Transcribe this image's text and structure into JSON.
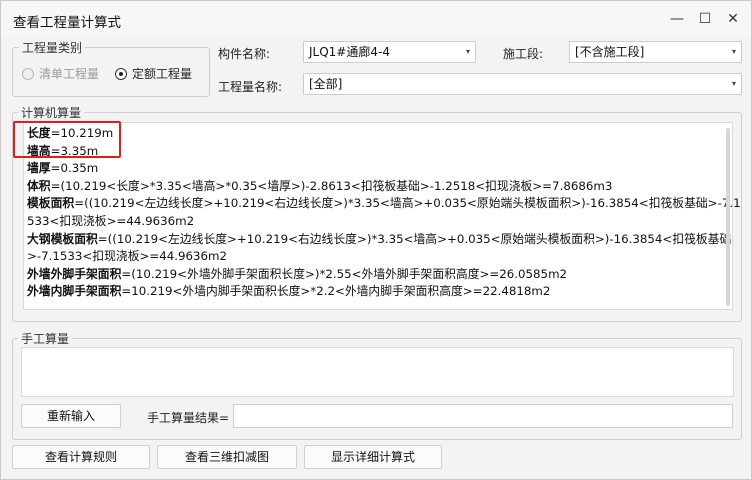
{
  "window": {
    "title": "查看工程量计算式",
    "min_icon": "—",
    "max_icon": "☐",
    "close_icon": "✕"
  },
  "qty_type": {
    "legend": "工程量类别",
    "option1": "清单工程量",
    "option2": "定额工程量",
    "selected": "定额工程量"
  },
  "form": {
    "component_label": "构件名称:",
    "component_value": "JLQ1#通廊4-4",
    "stage_label": "施工段:",
    "stage_value": "[不含施工段]",
    "qtyname_label": "工程量名称:",
    "qtyname_value": "[全部]",
    "dropdown_icon": "▾"
  },
  "computer": {
    "legend": "计算机算量",
    "lines": [
      {
        "key": "长度",
        "rest": "=10.219m"
      },
      {
        "key": "墙高",
        "rest": "=3.35m"
      },
      {
        "key": "墙厚",
        "rest": "=0.35m"
      },
      {
        "key": "体积",
        "rest": "=(10.219<长度>*3.35<墙高>*0.35<墙厚>)-2.8613<扣筏板基础>-1.2518<扣现浇板>=7.8686m3"
      },
      {
        "key": "模板面积",
        "rest": "=((10.219<左边线长度>+10.219<右边线长度>)*3.35<墙高>+0.035<原始端头模板面积>)-16.3854<扣筏板基础>-7.1"
      },
      {
        "key": "",
        "rest": "533<扣现浇板>=44.9636m2"
      },
      {
        "key": "大钢模板面积",
        "rest": "=((10.219<左边线长度>+10.219<右边线长度>)*3.35<墙高>+0.035<原始端头模板面积>)-16.3854<扣筏板基础"
      },
      {
        "key": "",
        "rest": ">-7.1533<扣现浇板>=44.9636m2"
      },
      {
        "key": "外墙外脚手架面积",
        "rest": "=(10.219<外墙外脚手架面积长度>)*2.55<外墙外脚手架面积高度>=26.0585m2"
      },
      {
        "key": "外墙内脚手架面积",
        "rest": "=10.219<外墙内脚手架面积长度>*2.2<外墙内脚手架面积高度>=22.4818m2"
      }
    ]
  },
  "manual": {
    "legend": "手工算量",
    "reinput_button": "重新输入",
    "result_label": "手工算量结果="
  },
  "footer": {
    "rules_button": "查看计算规则",
    "view3d_button": "查看三维扣减图",
    "detail_button": "显示详细计算式"
  }
}
